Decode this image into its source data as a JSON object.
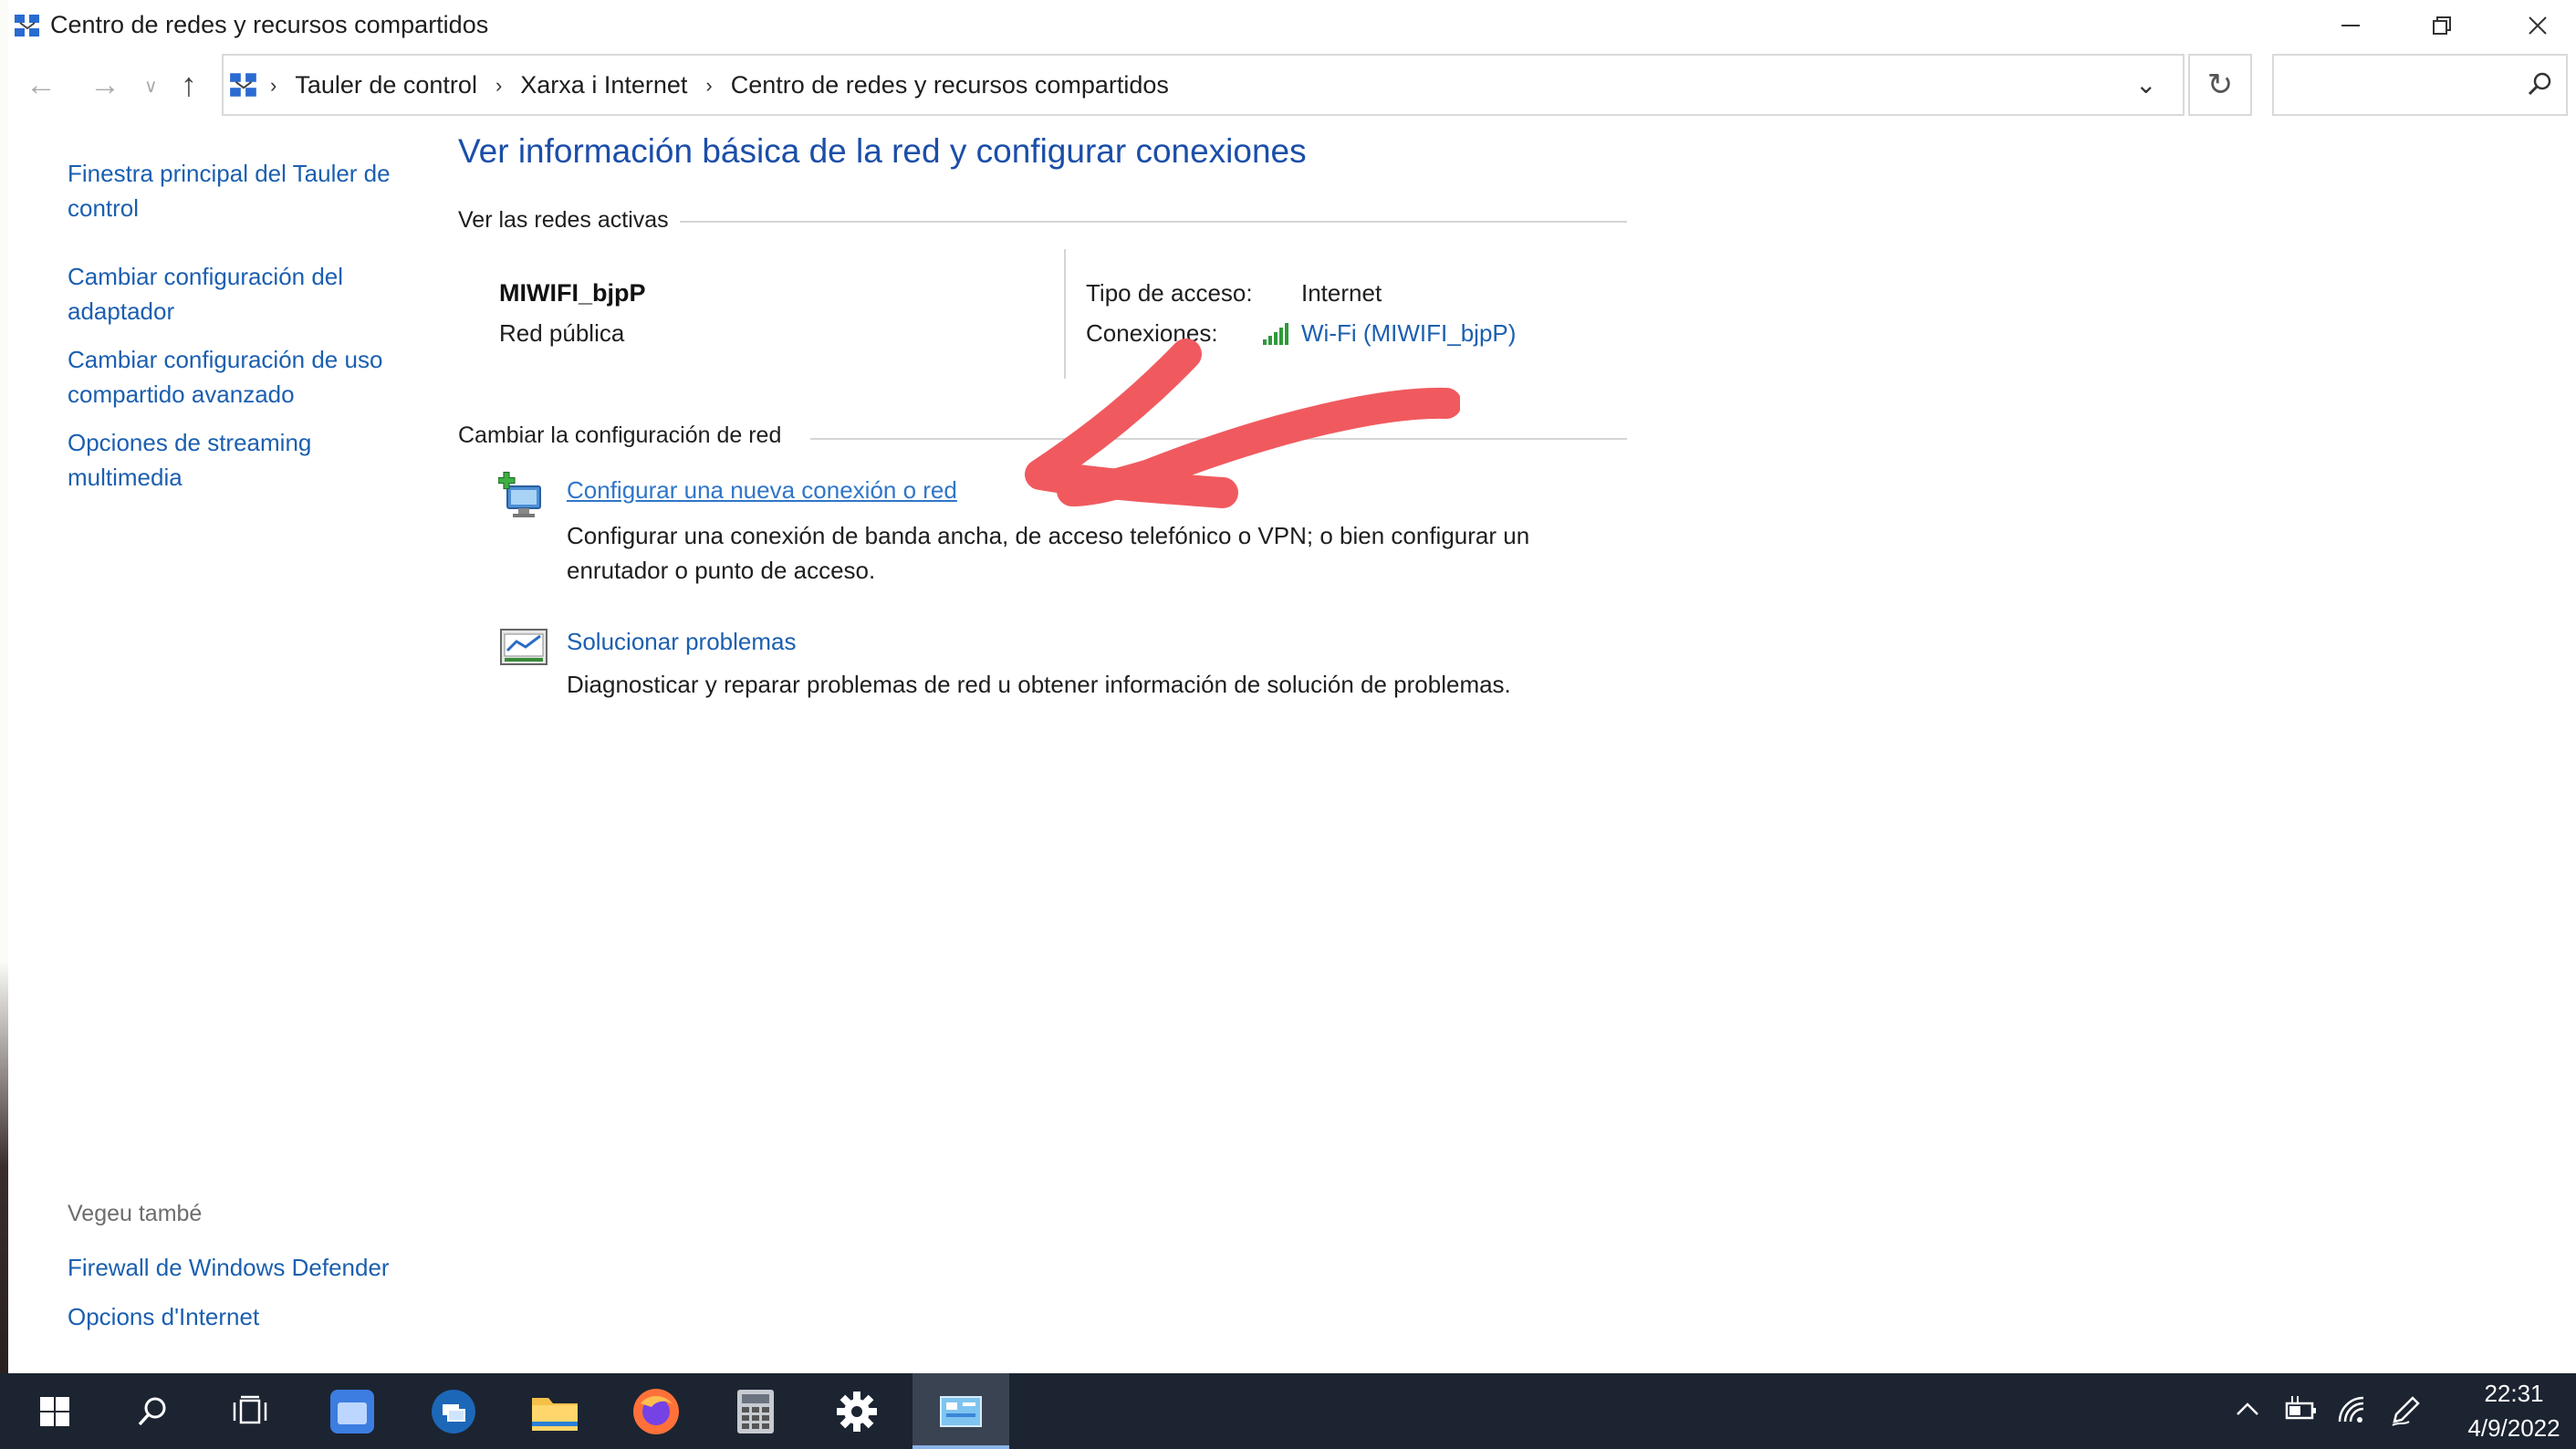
{
  "window": {
    "title": "Centro de redes y recursos compartidos",
    "buttons": {
      "minimize": "—",
      "maximize": "❐",
      "close": "✕"
    }
  },
  "address": {
    "crumbs": [
      "Tauler de control",
      "Xarxa i Internet",
      "Centro de redes y recursos compartidos"
    ],
    "search_placeholder": ""
  },
  "sidebar": {
    "links": [
      "Finestra principal del Tauler de control",
      "Cambiar configuración del adaptador",
      "Cambiar configuración de uso compartido avanzado",
      "Opciones de streaming multimedia"
    ],
    "see_also_label": "Vegeu també",
    "see_also": [
      "Firewall de Windows Defender",
      "Opcions d'Internet"
    ]
  },
  "main": {
    "title": "Ver información básica de la red y configurar conexiones",
    "active_networks_label": "Ver las redes activas",
    "network": {
      "name": "MIWIFI_bjpP",
      "type": "Red pública",
      "access_label": "Tipo de acceso:",
      "access_value": "Internet",
      "connections_label": "Conexiones:",
      "connections_value": "Wi-Fi (MIWIFI_bjpP)"
    },
    "change_label": "Cambiar la configuración de red",
    "tasks": [
      {
        "title": "Configurar una nueva conexión o red",
        "desc": "Configurar una conexión de banda ancha, de acceso telefónico o VPN; o bien configurar un enrutador o punto de acceso."
      },
      {
        "title": "Solucionar problemas",
        "desc": "Diagnosticar y reparar problemas de red u obtener información de solución de problemas."
      }
    ]
  },
  "annotation": {
    "color": "#f05a5f"
  },
  "taskbar": {
    "time": "22:31",
    "date": "4/9/2022"
  }
}
